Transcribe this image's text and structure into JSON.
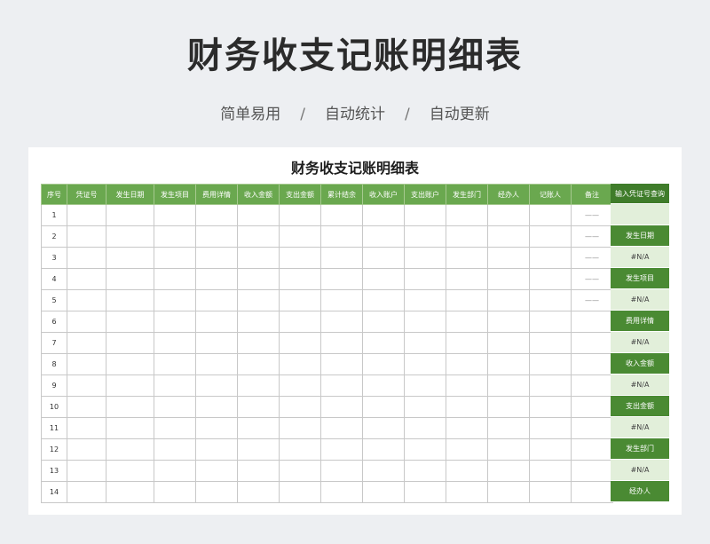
{
  "header": {
    "title": "财务收支记账明细表",
    "features": [
      "简单易用",
      "自动统计",
      "自动更新"
    ],
    "separator": "/"
  },
  "sheet": {
    "title": "财务收支记账明细表",
    "columns": [
      "序号",
      "凭证号",
      "发生日期",
      "发生项目",
      "费用详情",
      "收入金额",
      "支出金额",
      "累计结余",
      "收入账户",
      "支出账户",
      "发生部门",
      "经办人",
      "记账人",
      "备注"
    ],
    "rows": [
      {
        "no": "1",
        "remark": "——"
      },
      {
        "no": "2",
        "remark": "——"
      },
      {
        "no": "3",
        "remark": "——"
      },
      {
        "no": "4",
        "remark": "——"
      },
      {
        "no": "5",
        "remark": "——"
      },
      {
        "no": "6",
        "remark": ""
      },
      {
        "no": "7",
        "remark": ""
      },
      {
        "no": "8",
        "remark": ""
      },
      {
        "no": "9",
        "remark": ""
      },
      {
        "no": "10",
        "remark": ""
      },
      {
        "no": "11",
        "remark": ""
      },
      {
        "no": "12",
        "remark": ""
      },
      {
        "no": "13",
        "remark": ""
      },
      {
        "no": "14",
        "remark": ""
      }
    ]
  },
  "lookup": {
    "header": "输入凭证号查询",
    "input_value": "",
    "fields": [
      {
        "label": "发生日期",
        "value": "#N/A"
      },
      {
        "label": "发生项目",
        "value": "#N/A"
      },
      {
        "label": "费用详情",
        "value": "#N/A"
      },
      {
        "label": "收入金额",
        "value": "#N/A"
      },
      {
        "label": "支出金额",
        "value": "#N/A"
      },
      {
        "label": "发生部门",
        "value": "#N/A"
      },
      {
        "label": "经办人",
        "value": ""
      }
    ]
  },
  "colors": {
    "header_green": "#6aa84f",
    "lookup_dark_green": "#4a8a33",
    "lookup_light_green": "#e2efda"
  }
}
